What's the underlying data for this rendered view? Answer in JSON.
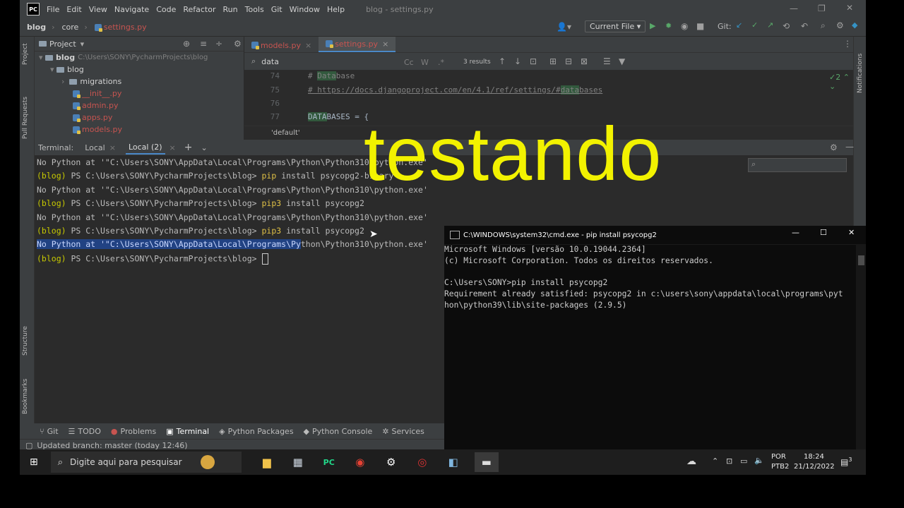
{
  "menubar": {
    "logo": "PC",
    "items": [
      "File",
      "Edit",
      "View",
      "Navigate",
      "Code",
      "Refactor",
      "Run",
      "Tools",
      "Git",
      "Window",
      "Help"
    ],
    "window_title": "blog - settings.py"
  },
  "navbar": {
    "breadcrumbs": [
      "blog",
      "core",
      "settings.py"
    ],
    "run_config": "Current File",
    "vcs_label": "Git:"
  },
  "sidebar": {
    "project_label": "Project",
    "pull_requests_label": "Pull Requests",
    "structure_label": "Structure",
    "bookmarks_label": "Bookmarks",
    "notifications_label": "Notifications"
  },
  "project_tree": {
    "root_name": "blog",
    "root_path": "C:\\Users\\SONY\\PycharmProjects\\blog",
    "folder": "blog",
    "items": [
      {
        "name": "migrations",
        "kind": "folder"
      },
      {
        "name": "__init__.py",
        "kind": "file"
      },
      {
        "name": "admin.py",
        "kind": "file"
      },
      {
        "name": "apps.py",
        "kind": "file"
      },
      {
        "name": "models.py",
        "kind": "file"
      }
    ]
  },
  "editor": {
    "tabs": [
      "models.py",
      "settings.py"
    ],
    "active_tab": "settings.py",
    "search_query": "data",
    "search_results": "3 results",
    "case_label": "Cc",
    "word_label": "W",
    "regex_label": ".*",
    "problems_count": "2",
    "lines": [
      {
        "num": "74",
        "prefix": "# ",
        "match": "Data",
        "suffix": "base"
      },
      {
        "num": "75",
        "prefix": "# https://docs.djangoproject.com/en/4.1/ref/settings/#",
        "match": "data",
        "suffix": "bases"
      },
      {
        "num": "76",
        "prefix": "",
        "match": "",
        "suffix": ""
      },
      {
        "num": "77",
        "prefix": "",
        "match": "DATA",
        "suffix": "BASES = {"
      }
    ],
    "breadcrumb_footer": "'default'"
  },
  "terminal": {
    "label": "Terminal:",
    "tabs": [
      "Local",
      "Local (2)"
    ],
    "venv": "(blog)",
    "prompt": " PS C:\\Users\\SONY\\PycharmProjects\\blog> ",
    "lines": [
      {
        "type": "out",
        "text": "No Python at '\"C:\\Users\\SONY\\AppData\\Local\\Programs\\Python\\Python310\\python.exe'"
      },
      {
        "type": "cmd",
        "cmd": "pip",
        "args": " install psycopg2-binary"
      },
      {
        "type": "out",
        "text": "No Python at '\"C:\\Users\\SONY\\AppData\\Local\\Programs\\Python\\Python310\\python.exe'"
      },
      {
        "type": "cmd",
        "cmd": "pip3",
        "args": " install psycopg2"
      },
      {
        "type": "out",
        "text": "No Python at '\"C:\\Users\\SONY\\AppData\\Local\\Programs\\Python\\Python310\\python.exe'"
      },
      {
        "type": "cmd",
        "cmd": "pip3",
        "args": " install psycopg2"
      },
      {
        "type": "sel",
        "selected": "No Python at '\"C:\\Users\\SONY\\AppData\\Local\\Programs\\Py",
        "rest": "thon\\Python310\\python.exe'"
      },
      {
        "type": "prompt"
      }
    ]
  },
  "bottom_tools": [
    "Git",
    "TODO",
    "Problems",
    "Terminal",
    "Python Packages",
    "Python Console",
    "Services"
  ],
  "active_bottom_tool": "Terminal",
  "status_bar": "Updated branch: master (today 12:46)",
  "cmd_window": {
    "title": "C:\\WINDOWS\\system32\\cmd.exe - pip  install psycopg2",
    "lines": [
      "Microsoft Windows [versão 10.0.19044.2364]",
      "(c) Microsoft Corporation. Todos os direitos reservados.",
      "",
      "C:\\Users\\SONY>pip install psycopg2",
      "Requirement already satisfied: psycopg2 in c:\\users\\sony\\appdata\\local\\programs\\pyt",
      "hon\\python39\\lib\\site-packages (2.9.5)"
    ]
  },
  "overlay_text": "testando",
  "taskbar": {
    "search_placeholder": "Digite aqui para pesquisar",
    "lang": "POR",
    "layout": "PTB2",
    "time": "18:24",
    "date": "21/12/2022",
    "notif_count": "3"
  },
  "colors": {
    "ide_bg": "#2b2b2b",
    "panel_bg": "#3c3f41",
    "venv_yellow": "#c7c900",
    "overlay_yellow": "#f2f200",
    "cmd_bg": "#0c0c0c",
    "selection": "#214283"
  }
}
